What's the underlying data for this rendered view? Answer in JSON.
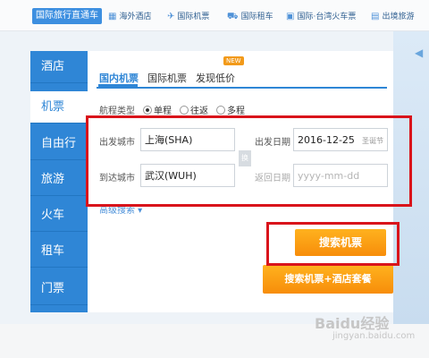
{
  "topnav": {
    "badge": "国际旅行直通车",
    "items": [
      {
        "label": "海外酒店",
        "icon": "hotel-icon"
      },
      {
        "label": "国际机票",
        "icon": "plane-icon"
      },
      {
        "label": "国际租车",
        "icon": "car-icon"
      },
      {
        "label": "国际·台湾火车票",
        "icon": "train-icon"
      },
      {
        "label": "出境旅游",
        "icon": "luggage-icon"
      }
    ]
  },
  "sidebar": {
    "items": [
      {
        "label": "酒店"
      },
      {
        "label": "机票"
      },
      {
        "label": "自由行"
      },
      {
        "label": "旅游"
      },
      {
        "label": "火车"
      },
      {
        "label": "租车"
      },
      {
        "label": "门票"
      }
    ],
    "active": "机票"
  },
  "tabs": {
    "domestic": "国内机票",
    "international": "国际机票",
    "lowprice": "发现低价",
    "new_badge": "NEW"
  },
  "trip": {
    "label": "航程类型",
    "oneway": "单程",
    "roundtrip": "往返",
    "multi": "多程",
    "selected": "单程"
  },
  "form": {
    "from_label": "出发城市",
    "from_value": "上海(SHA)",
    "to_label": "到达城市",
    "to_value": "武汉(WUH)",
    "swap_label": "换",
    "depart_label": "出发日期",
    "depart_value": "2016-12-25",
    "depart_hint": "圣诞节",
    "return_label": "返回日期",
    "return_placeholder": "yyyy-mm-dd"
  },
  "advanced": "高级搜索 ▾",
  "buttons": {
    "search": "搜索机票",
    "search_package": "搜索机票+酒店套餐"
  },
  "watermark": {
    "main": "Baidu经验",
    "sub": "jingyan.baidu.com"
  },
  "colors": {
    "accent": "#2f86d6",
    "button": "#f78d0a",
    "highlight": "#d9141b"
  }
}
